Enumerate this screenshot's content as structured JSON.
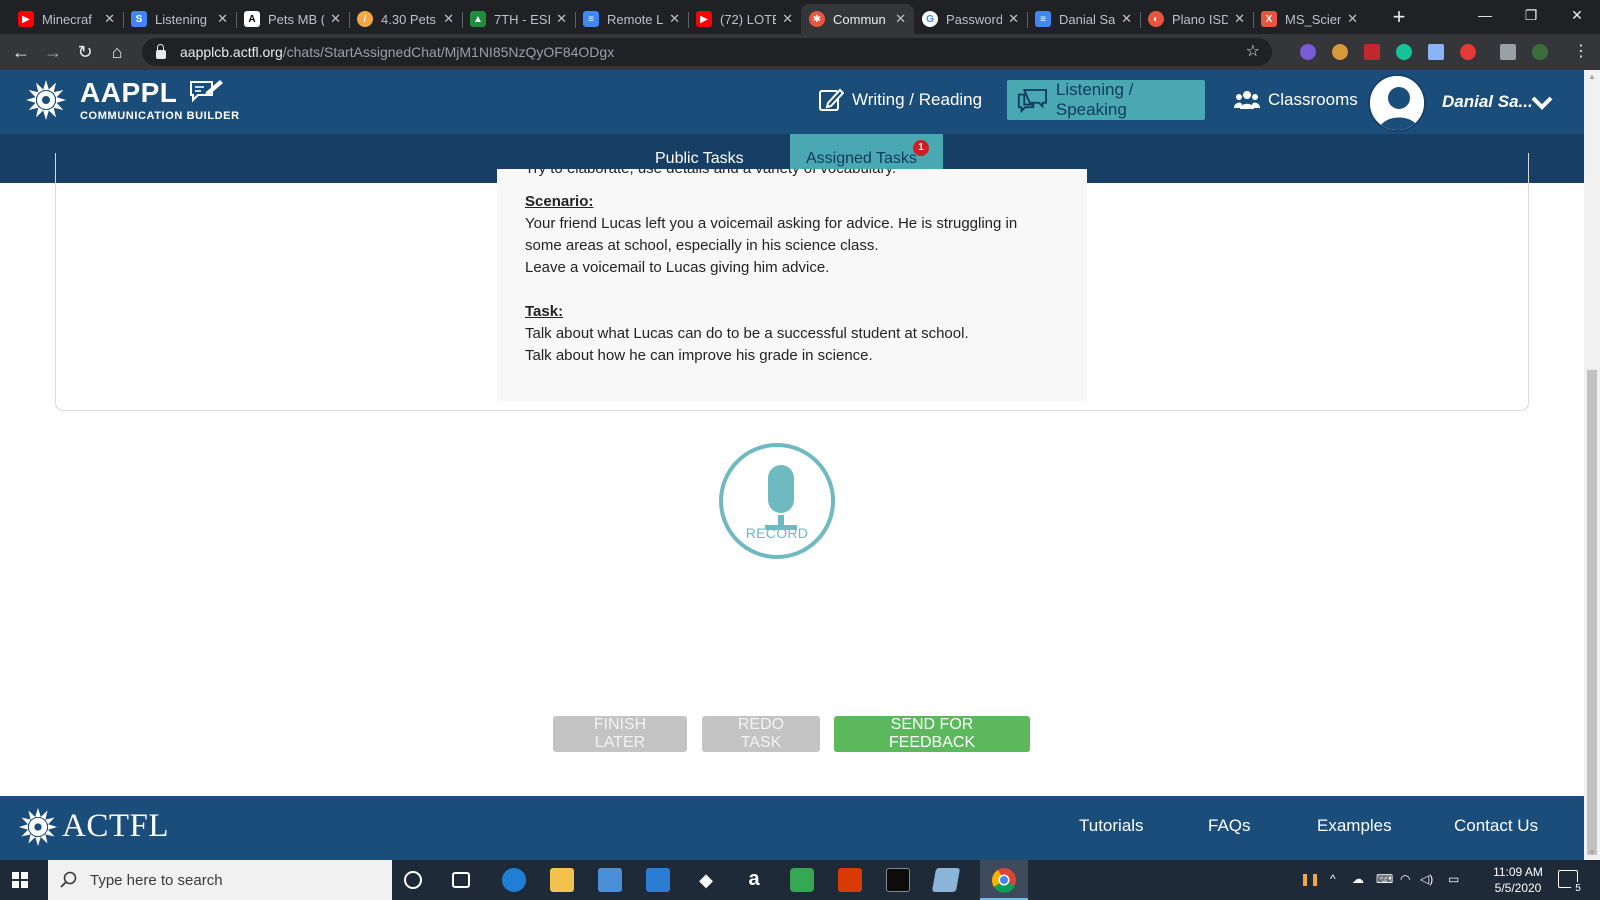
{
  "browser": {
    "tabs": [
      {
        "title": "Minecraf",
        "favicon_color": "#ff0000",
        "favicon_glyph": "▶"
      },
      {
        "title": "Listening",
        "favicon_color": "#4285f4",
        "favicon_glyph": "S"
      },
      {
        "title": "Pets MB (",
        "favicon_color": "#ffffff",
        "favicon_glyph": "A"
      },
      {
        "title": "4.30 Pets",
        "favicon_color": "#f4a742",
        "favicon_glyph": "/"
      },
      {
        "title": "7TH - ESI",
        "favicon_color": "#1e8e3e",
        "favicon_glyph": "▲"
      },
      {
        "title": "Remote L",
        "favicon_color": "#4285f4",
        "favicon_glyph": "≡"
      },
      {
        "title": "(72) LOTE",
        "favicon_color": "#ff0000",
        "favicon_glyph": "▶"
      },
      {
        "title": "Commun",
        "favicon_color": "#e8553f",
        "favicon_glyph": "✱"
      },
      {
        "title": "Password",
        "favicon_color": "#ffffff",
        "favicon_glyph": "G"
      },
      {
        "title": "Danial Sa",
        "favicon_color": "#4285f4",
        "favicon_glyph": "≡"
      },
      {
        "title": "Plano ISD",
        "favicon_color": "#e8553f",
        "favicon_glyph": "◐"
      },
      {
        "title": "MS_Scien",
        "favicon_color": "#e8553f",
        "favicon_glyph": "X"
      }
    ],
    "active_tab_index": 7,
    "url_host": "aapplcb.actfl.org",
    "url_path": "/chats/StartAssignedChat/MjM1NI85NzQyOF84ODgx"
  },
  "header": {
    "brand_name": "AAPPL",
    "brand_sub": "COMMUNICATION BUILDER",
    "nav": {
      "writing": "Writing / Reading",
      "listening": "Listening / Speaking",
      "classrooms": "Classrooms"
    },
    "user_name": "Danial Sa..."
  },
  "subnav": {
    "public": "Public Tasks",
    "assigned": "Assigned Tasks",
    "assigned_badge": "1"
  },
  "task": {
    "cut_line": "Try to elaborate, use details and a variety of vocabulary.",
    "scenario_heading": "Scenario:",
    "scenario_lines": [
      "Your friend Lucas left you a voicemail asking for advice. He is struggling in",
      "some areas at school, especially in his science class.",
      "Leave a voicemail to Lucas giving him advice."
    ],
    "task_heading": "Task:",
    "task_lines": [
      "Talk about what Lucas can do to be a successful student at school.",
      "Talk about how he can improve his grade in science."
    ]
  },
  "record": {
    "label": "RECORD"
  },
  "actions": {
    "finish_later": "FINISH LATER",
    "redo_task": "REDO TASK",
    "send_feedback": "SEND FOR FEEDBACK"
  },
  "footer": {
    "brand": "ACTFL",
    "links": [
      "Tutorials",
      "FAQs",
      "Examples",
      "Contact Us"
    ]
  },
  "taskbar": {
    "search_placeholder": "Type here to search",
    "time": "11:09 AM",
    "date": "5/5/2020",
    "notification_count": "5"
  },
  "colors": {
    "header_blue": "#1b4d7a",
    "subnav_blue": "#173f66",
    "accent_teal": "#4aa8b2",
    "record_teal": "#6fb9c0",
    "send_green": "#5cb85c",
    "disabled_grey": "#c4c4c4",
    "badge_red": "#cc1f24"
  }
}
